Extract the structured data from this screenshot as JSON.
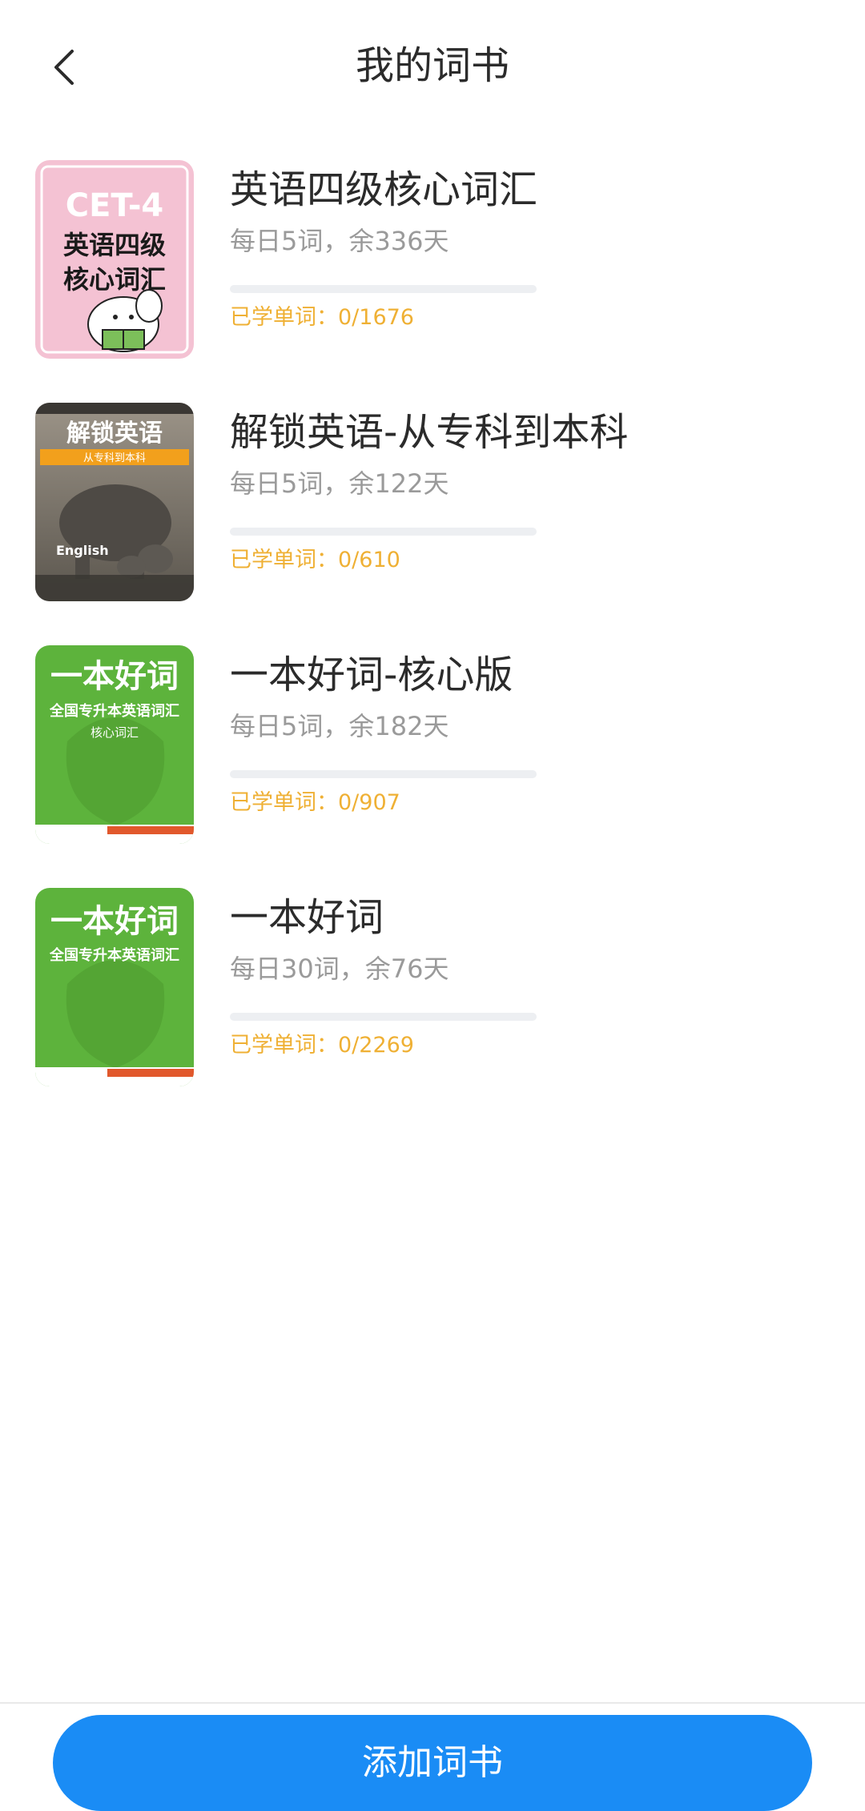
{
  "header": {
    "title": "我的词书",
    "back_icon": "chevron-left-icon"
  },
  "books": [
    {
      "title": "英语四级核心词汇",
      "plan": "每日5词，余336天",
      "learned": "已学单词：0/1676",
      "progress": 0,
      "cover": {
        "line1": "CET-4",
        "line2": "英语四级",
        "line3": "核心词汇",
        "bg_color": "#f4c2d3",
        "icon": "elephant-reading-icon"
      }
    },
    {
      "title": "解锁英语-从专科到本科",
      "plan": "每日5词，余122天",
      "learned": "已学单词：0/610",
      "progress": 0,
      "cover": {
        "line1": "解锁英语",
        "line2": "从专科到本科",
        "line3": "English",
        "bg_color": "#6f6a62",
        "accent_color": "#f2a01c",
        "icon": "elephant-family-photo"
      }
    },
    {
      "title": "一本好词-核心版",
      "plan": "每日5词，余182天",
      "learned": "已学单词：0/907",
      "progress": 0,
      "cover": {
        "line1": "一本好词",
        "line2": "全国专升本英语词汇",
        "line3": "核心词汇",
        "bg_color": "#5db33c"
      }
    },
    {
      "title": "一本好词",
      "plan": "每日30词，余76天",
      "learned": "已学单词：0/2269",
      "progress": 0,
      "cover": {
        "line1": "一本好词",
        "line2": "全国专升本英语词汇",
        "bg_color": "#5db33c"
      }
    }
  ],
  "footer": {
    "add_button_label": "添加词书",
    "accent_color": "#1a8cf5"
  },
  "colors": {
    "progress_track": "#edeff2",
    "learned_text": "#efb034",
    "secondary_text": "#9a9a9a"
  }
}
